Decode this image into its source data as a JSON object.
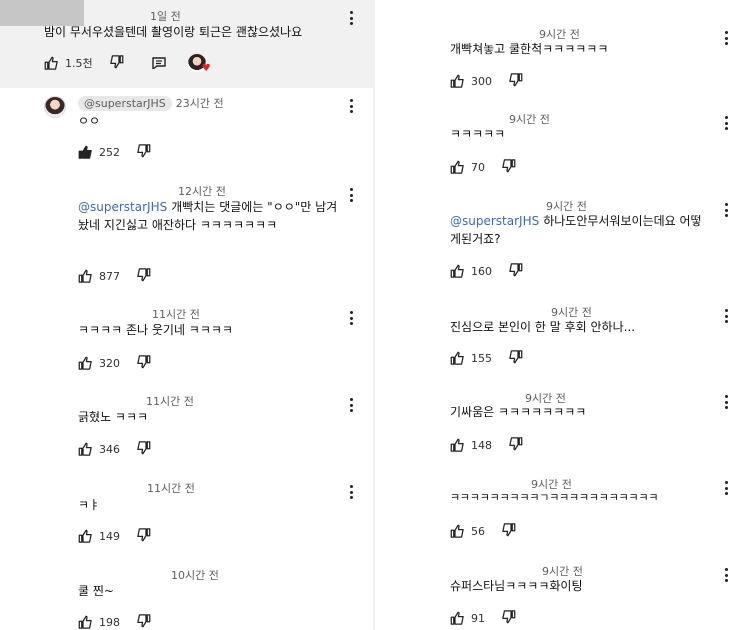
{
  "left": {
    "top_comment": {
      "time": "1일 전",
      "text": "밤이 무서우셨을텐데 촬영이랑 퇴근은 괜찮으셨나요",
      "likes": "1.5천"
    },
    "reply_main": {
      "handle": "@superstarJHS",
      "time": "23시간 전",
      "text": "ㅇㅇ",
      "likes": "252"
    },
    "replies": [
      {
        "time": "12시간 전",
        "mention": "@superstarJHS",
        "text": "개빡치는 댓글에는 \"ㅇㅇ\"만 남겨놨네 지긴싫고 애잔하다 ㅋㅋㅋㅋㅋㅋㅋ",
        "likes": "877"
      },
      {
        "time": "11시간 전",
        "text": "ㅋㅋㅋㅋ 존나 웃기네 ㅋㅋㅋㅋ",
        "likes": "320"
      },
      {
        "time": "11시간 전",
        "text": "긁혔노 ㅋㅋㅋ",
        "likes": "346"
      },
      {
        "time": "11시간 전",
        "text": "ㅋㅑ",
        "likes": "149"
      },
      {
        "time": "10시간 전",
        "text": "쿨 찐~",
        "likes": "198"
      }
    ]
  },
  "right": {
    "replies": [
      {
        "time": "9시간 전",
        "text": "개빡쳐놓고 쿨한척ㅋㅋㅋㅋㅋㅋ",
        "likes": "300"
      },
      {
        "time": "9시간 전",
        "text": "ㅋㅋㅋㅋㅋ",
        "likes": "70"
      },
      {
        "time": "9시간 전",
        "mention": "@superstarJHS",
        "text": "하나도안무서워보이는데요 어떻게된거죠?",
        "likes": "160"
      },
      {
        "time": "9시간 전",
        "text": "진심으로 본인이 한 말 후회 안하나...",
        "likes": "155"
      },
      {
        "time": "9시간 전",
        "text": "기싸움은 ㅋㅋㅋㅋㅋㅋㅋㅋ",
        "likes": "148"
      },
      {
        "time": "9시간 전",
        "text": "ㅋㅋㅋㅋㅋㅋㅋㅋㅋㄱㅋㅋㅋㅋㅋㅋㅋㅋㅋㅋㅋ",
        "likes": "56"
      },
      {
        "time": "9시간 전",
        "text": "슈퍼스타님ㅋㅋㅋㅋ화이팅",
        "likes": "91"
      }
    ]
  },
  "icons": {
    "like": "thumbs-up-icon",
    "dislike": "thumbs-down-icon",
    "reply": "reply-icon",
    "more": "more-vert-icon",
    "heart": "heart-icon"
  }
}
